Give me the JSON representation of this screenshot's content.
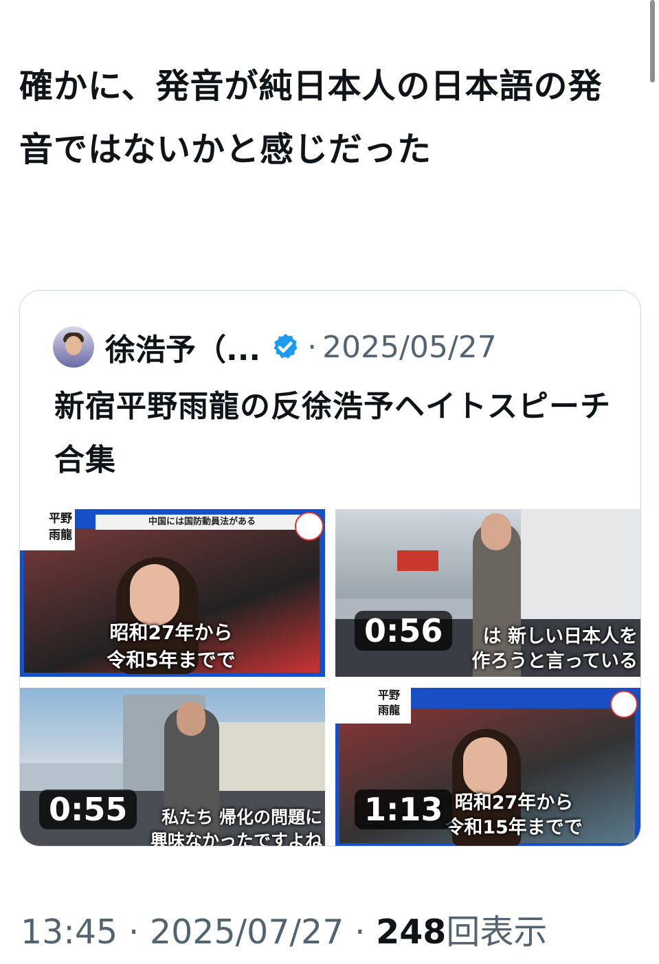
{
  "tweet": {
    "text": "確かに、発音が純日本人の日本語の発音ではないかと感じだった"
  },
  "quote": {
    "author_name": "徐浩予（...",
    "separator": "·",
    "date": "2025/05/27",
    "text": "新宿平野雨龍の反徐浩予ヘイトスピーチ合集",
    "verified_color": "#1d9bf0"
  },
  "media": [
    {
      "caption_line1": "昭和27年から",
      "caption_line2": "令和5年までで",
      "banner": "中国には国防動員法がある",
      "name_tag": "平野\n雨龍",
      "duration": ""
    },
    {
      "caption_line1": "は 新しい日本人を",
      "caption_line2": "作ろうと言っている",
      "duration": "0:56"
    },
    {
      "caption_line1": "私たち 帰化の問題に",
      "caption_line2": "興味なかったですよね",
      "duration": "0:55"
    },
    {
      "caption_line1": "昭和27年から",
      "caption_line2": "令和15年までで",
      "name_tag": "平野\n雨龍",
      "duration": "1:13"
    }
  ],
  "footer": {
    "time": "13:45",
    "separator": "·",
    "date": "2025/07/27",
    "views_count": "248",
    "views_label": "回表示"
  }
}
